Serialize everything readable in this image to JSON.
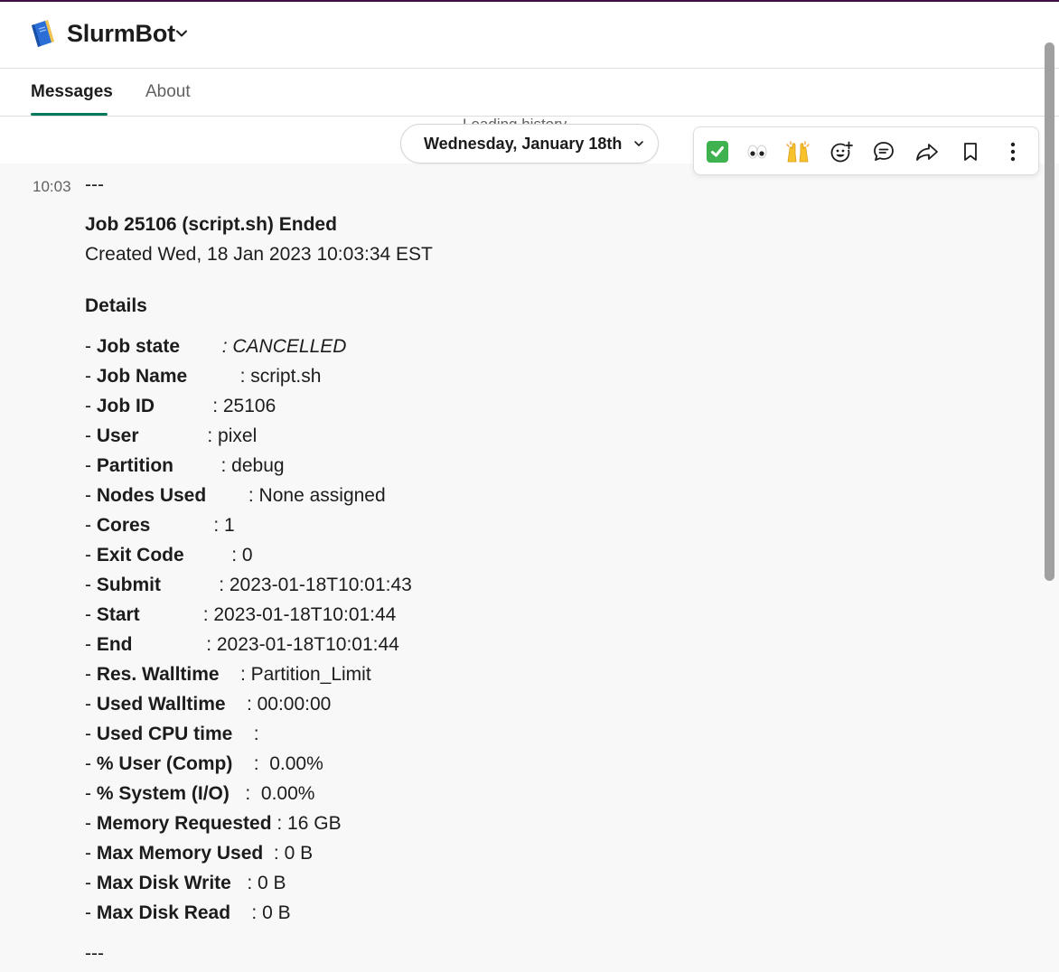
{
  "app": {
    "name": "SlurmBot"
  },
  "tabs": [
    {
      "label": "Messages",
      "active": true
    },
    {
      "label": "About",
      "active": false
    }
  ],
  "history": {
    "loading_text": "Loading history"
  },
  "date_divider": {
    "label": "Wednesday, January 18th"
  },
  "actions": [
    {
      "icon": "white-check-mark-emoji-icon"
    },
    {
      "icon": "eyes-emoji-icon"
    },
    {
      "icon": "raised-hands-emoji-icon"
    },
    {
      "icon": "add-reaction-icon"
    },
    {
      "icon": "reply-in-thread-icon"
    },
    {
      "icon": "share-message-icon"
    },
    {
      "icon": "save-bookmark-icon"
    },
    {
      "icon": "more-actions-icon"
    }
  ],
  "message": {
    "time": "10:03",
    "separator_top": "---",
    "title": "Job 25106 (script.sh) Ended",
    "created": "Created Wed, 18 Jan 2023 10:03:34 EST",
    "details_heading": "Details",
    "details": [
      {
        "key": "Job state",
        "pad": "        ",
        "value": ": CANCELLED",
        "italic": true
      },
      {
        "key": "Job Name",
        "pad": "          ",
        "value": ": script.sh"
      },
      {
        "key": "Job ID",
        "pad": "           ",
        "value": ": 25106"
      },
      {
        "key": "User",
        "pad": "             ",
        "value": ": pixel"
      },
      {
        "key": "Partition",
        "pad": "         ",
        "value": ": debug"
      },
      {
        "key": "Nodes Used",
        "pad": "        ",
        "value": ": None assigned"
      },
      {
        "key": "Cores",
        "pad": "            ",
        "value": ": 1"
      },
      {
        "key": "Exit Code",
        "pad": "         ",
        "value": ": 0"
      },
      {
        "key": "Submit",
        "pad": "           ",
        "value": ": 2023-01-18T10:01:43"
      },
      {
        "key": "Start",
        "pad": "            ",
        "value": ": 2023-01-18T10:01:44"
      },
      {
        "key": "End",
        "pad": "              ",
        "value": ": 2023-01-18T10:01:44"
      },
      {
        "key": "Res. Walltime",
        "pad": "    ",
        "value": ": Partition_Limit"
      },
      {
        "key": "Used Walltime",
        "pad": "    ",
        "value": ": 00:00:00"
      },
      {
        "key": "Used CPU time",
        "pad": "    ",
        "value": ":"
      },
      {
        "key": "% User (Comp)",
        "pad": "    ",
        "value": ":  0.00%"
      },
      {
        "key": "% System (I/O)",
        "pad": "   ",
        "value": ":  0.00%"
      },
      {
        "key": "Memory Requested",
        "pad": " ",
        "value": ": 16 GB"
      },
      {
        "key": "Max Memory Used",
        "pad": "  ",
        "value": ": 0 B"
      },
      {
        "key": "Max Disk Write",
        "pad": "   ",
        "value": ": 0 B"
      },
      {
        "key": "Max Disk Read",
        "pad": "    ",
        "value": ": 0 B"
      }
    ],
    "separator_bottom": "---"
  }
}
